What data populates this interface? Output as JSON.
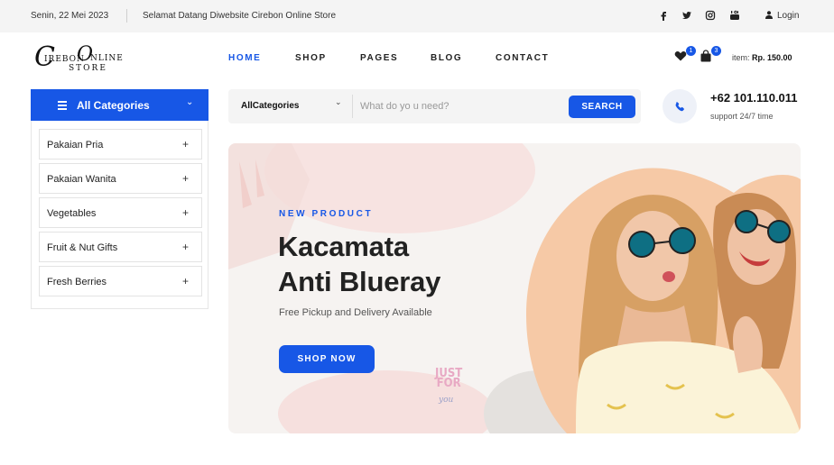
{
  "topbar": {
    "date": "Senin, 22 Mei 2023",
    "welcome": "Selamat Datang Diwebsite Cirebon Online Store",
    "social_icons": [
      "facebook-icon",
      "twitter-icon",
      "instagram-icon",
      "youtube-icon"
    ],
    "login_label": "Login"
  },
  "logo": {
    "big_c": "C",
    "small_top": "IREBON",
    "big_o": "O",
    "small_right": "NLINE",
    "small_bottom": "STORE"
  },
  "nav": {
    "items": [
      {
        "label": "HOME",
        "active": true
      },
      {
        "label": "SHOP",
        "active": false
      },
      {
        "label": "PAGES",
        "active": false
      },
      {
        "label": "BLOG",
        "active": false
      },
      {
        "label": "CONTACT",
        "active": false
      }
    ]
  },
  "header": {
    "wishlist_count": "1",
    "cart_count": "3",
    "item_label": "item:",
    "item_total": "Rp. 150.00"
  },
  "categories": {
    "title": "All Categories",
    "items": [
      {
        "label": "Pakaian Pria",
        "toggle": "+"
      },
      {
        "label": "Pakaian Wanita",
        "toggle": "+"
      },
      {
        "label": "Vegetables",
        "toggle": "+"
      },
      {
        "label": "Fruit & Nut Gifts",
        "toggle": "+"
      },
      {
        "label": "Fresh Berries",
        "toggle": "+"
      }
    ]
  },
  "search": {
    "category_label": "AllCategories",
    "placeholder": "What do yo u need?",
    "button_label": "SEARCH"
  },
  "contact": {
    "phone": "+62 101.110.011",
    "support": "support 24/7 time"
  },
  "hero": {
    "tag": "NEW PRODUCT",
    "title_line1": "Kacamata",
    "title_line2": "Anti Blueray",
    "subtitle": "Free Pickup and Delivery Available",
    "button_label": "SHOP NOW",
    "sticker_line1": "JUST",
    "sticker_line2": "FOR",
    "sticker_line3": "you"
  },
  "colors": {
    "accent": "#1757e6",
    "topbar_bg": "#f4f4f4",
    "hero_bg": "#f6f3f1"
  }
}
